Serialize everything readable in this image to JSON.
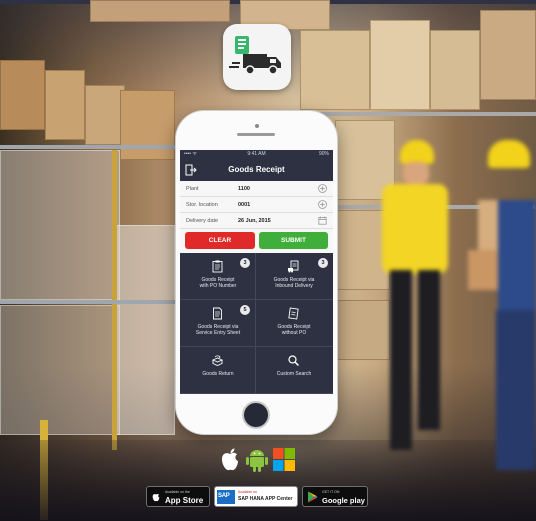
{
  "app_icon": {
    "name": "goods-receipt-truck"
  },
  "phone": {
    "status_bar": {
      "left": "•••• ᯤ",
      "time": "9:41 AM",
      "battery": "90%"
    },
    "nav": {
      "title": "Goods Receipt"
    },
    "form": {
      "rows": [
        {
          "label": "Plant",
          "value": "1100",
          "icon": "plus-circle-icon"
        },
        {
          "label": "Stor. location",
          "value": "0001",
          "icon": "plus-circle-icon"
        },
        {
          "label": "Delivery date",
          "value": "26 Jun, 2015",
          "icon": "calendar-icon"
        }
      ]
    },
    "buttons": {
      "clear": "CLEAR",
      "submit": "SUBMIT"
    },
    "tiles": [
      {
        "label": "Goods Receipt\nwith PO Number",
        "badge": "3",
        "icon": "clipboard-icon"
      },
      {
        "label": "Goods Receipt via\nInbound Delivery",
        "badge": "3",
        "icon": "truck-clipboard-icon"
      },
      {
        "label": "Goods Receipt via\nService Entry Sheet",
        "badge": "5",
        "icon": "document-icon"
      },
      {
        "label": "Goods Receipt\nwithout PO",
        "badge": "",
        "icon": "note-icon"
      },
      {
        "label": "Goods Return",
        "badge": "",
        "icon": "box-return-icon"
      },
      {
        "label": "Custom Search",
        "badge": "",
        "icon": "search-icon"
      }
    ]
  },
  "platforms": [
    "apple-icon",
    "android-icon",
    "windows-icon"
  ],
  "stores": {
    "appstore": {
      "small": "Available on the",
      "big": "App Store"
    },
    "sap": {
      "small": "Available on",
      "big": "SAP HANA APP Center"
    },
    "google": {
      "small": "GET IT ON",
      "big": "Google play"
    }
  },
  "colors": {
    "clear": "#e02a2a",
    "submit": "#3fae3a",
    "screen": "#2d3142",
    "worker_vest": "#f2d21a"
  }
}
